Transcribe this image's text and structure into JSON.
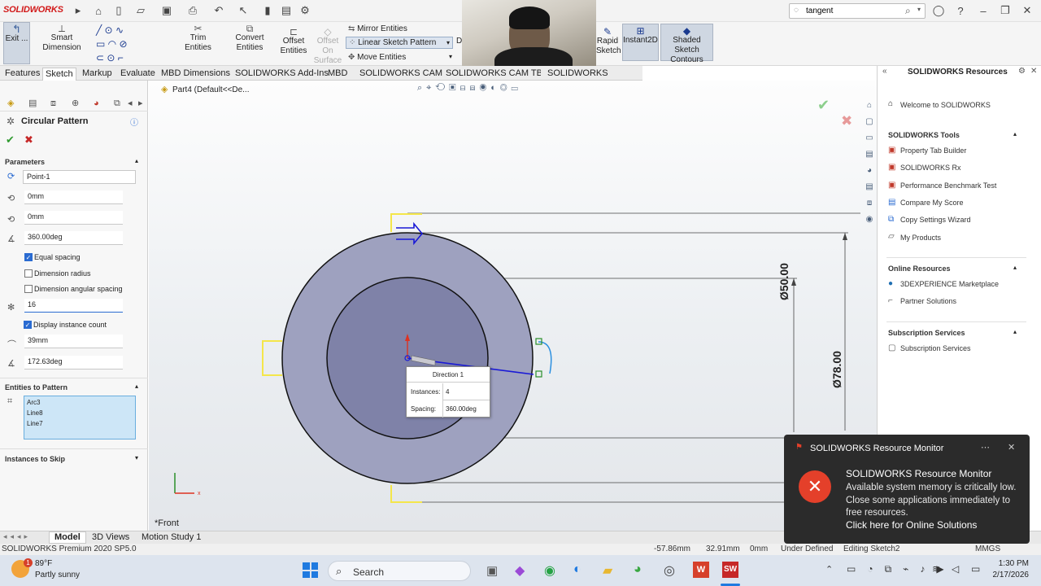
{
  "titlebar": {
    "logo": "SOLIDWORKS",
    "search_value": "tangent"
  },
  "command_manager": {
    "exit_sketch": "Exit ...",
    "smart_dimension": "Smart Dimension",
    "trim_entities": "Trim Entities",
    "convert_entities": "Convert Entities",
    "offset_entities_1": "Offset",
    "offset_entities_2": "Entities",
    "offset_on_surface_1": "Offset On",
    "offset_on_surface_2": "Surface",
    "mirror_entities": "Mirror Entities",
    "linear_sketch_pattern": "Linear Sketch Pattern",
    "move_entities": "Move Entities",
    "rapid_sketch_1": "Rapid",
    "rapid_sketch_2": "Sketch",
    "instant2d": "Instant2D",
    "shaded_1": "Shaded Sketch",
    "shaded_2": "Contours",
    "partial_d": "D"
  },
  "tabs": [
    "Features",
    "Sketch",
    "Markup",
    "Evaluate",
    "MBD Dimensions",
    "SOLIDWORKS Add-Ins",
    "MBD",
    "SOLIDWORKS CAM",
    "SOLIDWORKS CAM TBM",
    "SOLIDWORKS Inspection"
  ],
  "property_manager": {
    "title": "Circular Pattern",
    "parameters_label": "Parameters",
    "center_point": "Point-1",
    "center_x": "0mm",
    "center_y": "0mm",
    "angle": "360.00deg",
    "equal_spacing": "Equal spacing",
    "dimension_radius": "Dimension radius",
    "dimension_angular_spacing": "Dimension angular spacing",
    "instances": "16",
    "display_instance_count": "Display instance count",
    "radius": "39mm",
    "arc_angle": "172.63deg",
    "entities_label": "Entities to Pattern",
    "entities": [
      "Arc3",
      "Line8",
      "Line7"
    ],
    "instances_to_skip": "Instances to Skip"
  },
  "viewport": {
    "breadcrumb": "Part4  (Default<<De...",
    "view_label": "*Front",
    "dim_50": "Ø50.00",
    "dim_78": "Ø78.00",
    "callout": {
      "title": "Direction 1",
      "instances_label": "Instances:",
      "instances_value": "4",
      "spacing_label": "Spacing:",
      "spacing_value": "360.00deg"
    }
  },
  "task_pane": {
    "title": "SOLIDWORKS Resources",
    "welcome": "Welcome to SOLIDWORKS",
    "tools_header": "SOLIDWORKS Tools",
    "tools": [
      "Property Tab Builder",
      "SOLIDWORKS Rx",
      "Performance Benchmark Test",
      "Compare My Score",
      "Copy Settings Wizard",
      "My Products"
    ],
    "online_header": "Online Resources",
    "online": [
      "3DEXPERIENCE Marketplace",
      "Partner Solutions"
    ],
    "subscription_header": "Subscription Services",
    "subscription": [
      "Subscription Services"
    ]
  },
  "bottom_tabs": [
    "Model",
    "3D Views",
    "Motion Study 1"
  ],
  "status": {
    "product": "SOLIDWORKS Premium 2020 SP5.0",
    "x": "-57.86mm",
    "y": "32.91mm",
    "z": "0mm",
    "state": "Under Defined",
    "editing": "Editing Sketch2",
    "units": "MMGS"
  },
  "toast": {
    "header": "SOLIDWORKS Resource Monitor",
    "title": "SOLIDWORKS Resource Monitor",
    "body": "Available system memory is critically low. Close some applications immediately to free resources.",
    "link": "Click here for Online Solutions"
  },
  "taskbar": {
    "temp": "89°F",
    "weather": "Partly sunny",
    "search": "Search",
    "time": "1:30 PM",
    "date": "2/17/2026",
    "badge": "1"
  },
  "colors": {
    "accent": "#2a6bd1",
    "sketch_blue": "#1a1ad6",
    "disc_fill": "#9ea1bf",
    "toast_bg": "#2b2b2b",
    "error_red": "#e4402a"
  }
}
